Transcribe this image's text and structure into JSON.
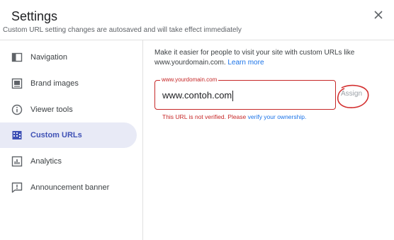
{
  "header": {
    "title": "Settings",
    "subtitle": "Custom URL setting changes are autosaved and will take effect immediately"
  },
  "sidebar": {
    "items": [
      {
        "label": "Navigation",
        "icon": "navigation-panel-icon",
        "active": false
      },
      {
        "label": "Brand images",
        "icon": "brand-image-icon",
        "active": false
      },
      {
        "label": "Viewer tools",
        "icon": "info-circle-icon",
        "active": false
      },
      {
        "label": "Custom URLs",
        "icon": "domain-icon",
        "active": true
      },
      {
        "label": "Analytics",
        "icon": "bar-chart-icon",
        "active": false
      },
      {
        "label": "Announcement banner",
        "icon": "announcement-icon",
        "active": false
      }
    ]
  },
  "main": {
    "description": "Make it easier for people to visit your site with custom URLs like www.yourdomain.com.",
    "learn_more": "Learn more",
    "field": {
      "label": "www.yourdomain.com",
      "value": "www.contoh.com"
    },
    "assign_label": "Assign",
    "error_text": "This URL is not verified. Please",
    "error_link": "verify your ownership."
  },
  "colors": {
    "accent": "#3f51b5",
    "active_bg": "#e8eaf6",
    "error": "#c62828",
    "link": "#1a73e8"
  }
}
